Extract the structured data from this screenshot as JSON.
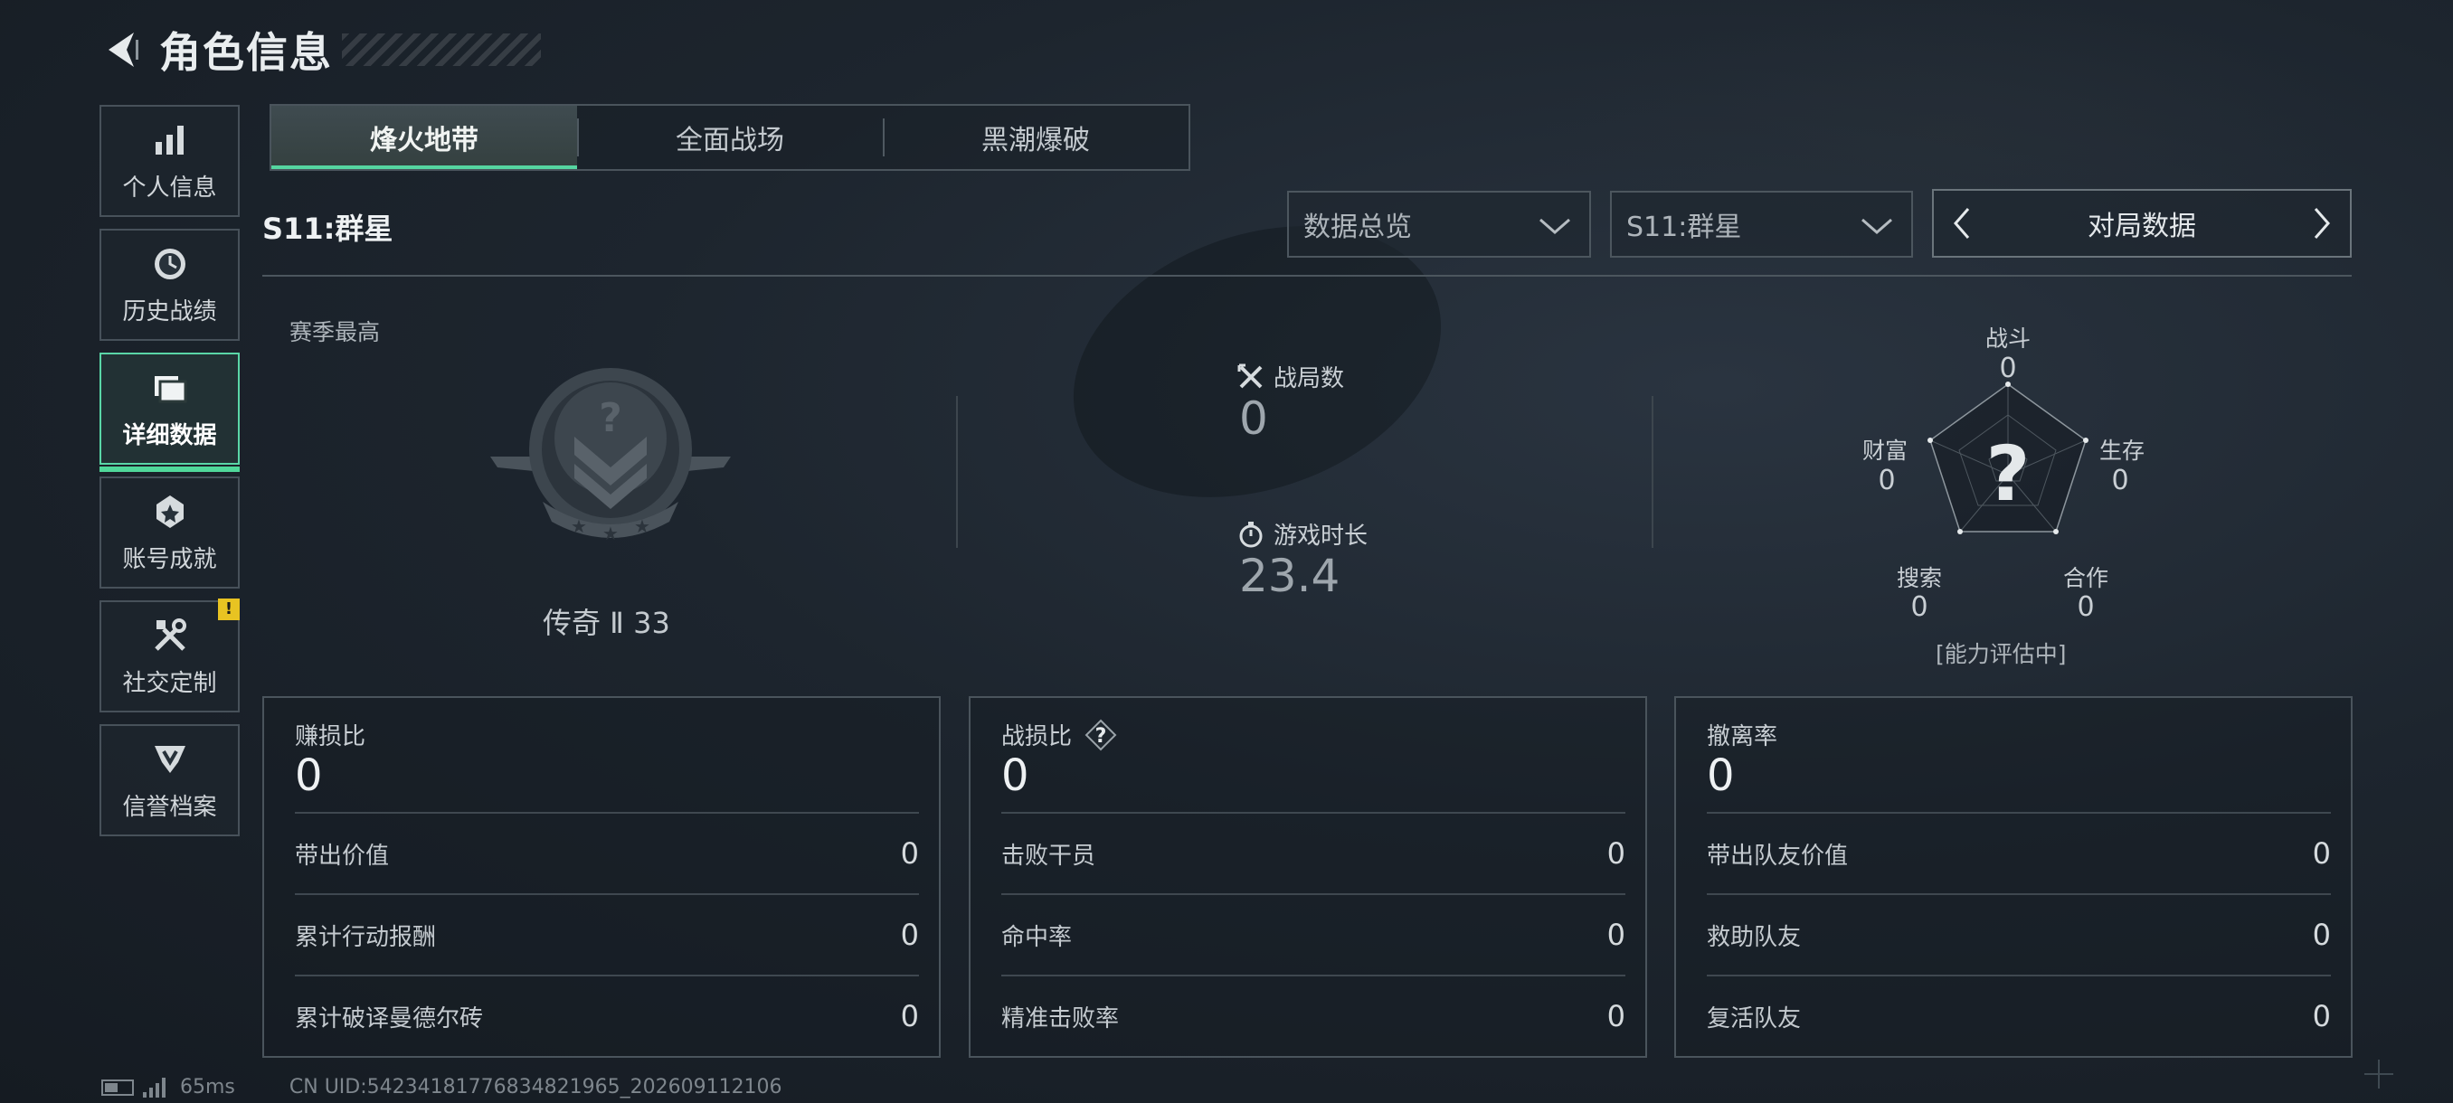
{
  "header": {
    "title": "角色信息"
  },
  "sidebar": {
    "items": [
      {
        "label": "个人信息",
        "icon": "bar-chart-icon"
      },
      {
        "label": "历史战绩",
        "icon": "clock-icon"
      },
      {
        "label": "详细数据",
        "icon": "folder-icon",
        "active": true
      },
      {
        "label": "账号成就",
        "icon": "achievement-icon"
      },
      {
        "label": "社交定制",
        "icon": "tools-icon",
        "badge": "!"
      },
      {
        "label": "信誉档案",
        "icon": "credit-badge-icon"
      }
    ]
  },
  "tabs": [
    {
      "label": "烽火地带",
      "active": true
    },
    {
      "label": "全面战场"
    },
    {
      "label": "黑潮爆破"
    }
  ],
  "season": {
    "title": "S11:群星"
  },
  "filters": {
    "overview": "数据总览",
    "season": "S11:群星",
    "pager_label": "对局数据"
  },
  "season_high": {
    "label": "赛季最高",
    "rank": "传奇 Ⅱ 33",
    "emblem_mark": "?"
  },
  "summary": {
    "matches_label": "战局数",
    "matches_value": "0",
    "playtime_label": "游戏时长",
    "playtime_value": "23.4"
  },
  "radar": {
    "center_mark": "?",
    "axes": [
      {
        "label": "战斗",
        "value": "0"
      },
      {
        "label": "生存",
        "value": "0"
      },
      {
        "label": "合作",
        "value": "0"
      },
      {
        "label": "搜索",
        "value": "0"
      },
      {
        "label": "财富",
        "value": "0"
      }
    ],
    "note": "[能力评估中]"
  },
  "cards": [
    {
      "title": "赚损比",
      "value": "0",
      "rows": [
        {
          "label": "带出价值",
          "value": "0"
        },
        {
          "label": "累计行动报酬",
          "value": "0"
        },
        {
          "label": "累计破译曼德尔砖",
          "value": "0"
        }
      ]
    },
    {
      "title": "战损比",
      "value": "0",
      "has_help": true,
      "rows": [
        {
          "label": "击败干员",
          "value": "0"
        },
        {
          "label": "命中率",
          "value": "0"
        },
        {
          "label": "精准击败率",
          "value": "0"
        }
      ]
    },
    {
      "title": "撤离率",
      "value": "0",
      "rows": [
        {
          "label": "带出队友价值",
          "value": "0"
        },
        {
          "label": "救助队友",
          "value": "0"
        },
        {
          "label": "复活队友",
          "value": "0"
        }
      ]
    }
  ],
  "footer": {
    "ping": "65ms",
    "uid": "CN UID:54234181776834821965_202609112106"
  },
  "colors": {
    "accent": "#55d5a0",
    "badge": "#e8c322"
  }
}
